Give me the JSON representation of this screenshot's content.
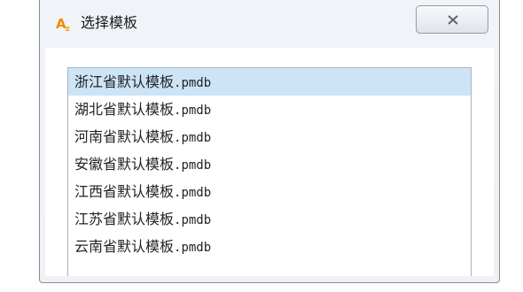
{
  "window": {
    "title": "选择模板",
    "icon": "app-az-icon"
  },
  "close_icon": "close-x-icon",
  "list": {
    "selected_index": 0,
    "items": [
      {
        "name": "浙江省默认模板",
        "ext": ".pmdb"
      },
      {
        "name": "湖北省默认模板",
        "ext": ".pmdb"
      },
      {
        "name": "河南省默认模板",
        "ext": ".pmdb"
      },
      {
        "name": "安徽省默认模板",
        "ext": ".pmdb"
      },
      {
        "name": "江西省默认模板",
        "ext": ".pmdb"
      },
      {
        "name": "江苏省默认模板",
        "ext": ".pmdb"
      },
      {
        "name": "云南省默认模板",
        "ext": ".pmdb"
      }
    ]
  },
  "colors": {
    "selection": "#cde4f7",
    "icon_orange": "#f08a00"
  }
}
